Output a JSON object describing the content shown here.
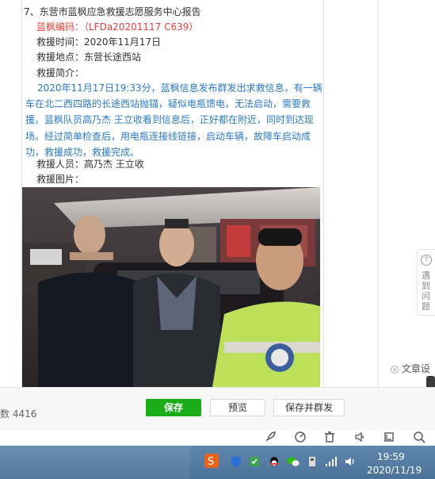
{
  "report": {
    "heading": "7、东营市蓝枫应急救援志愿服务中心报告",
    "code": "蓝枫编码：（LFDa20201117  C639）",
    "time": "救援时间：2020年11月17日",
    "place": "救援地点：东营长途西站",
    "intro_label": "救援简介：",
    "intro_lines": [
      "2020年11月17日19:33分，蓝枫信息发布群发出求救信息，有一辆",
      "车在北二西四路的长途西站抛锚，疑似电瓶馈电，无法启动，需要救",
      "援。蓝枫队员高乃杰  王立收看到信息后，正好都在附近，同时到达现",
      "场。经过简单检查后，用电瓶连接线链接，启动车辆，故障车启动成",
      "功，救援成功，救援完成。"
    ],
    "personnel": "救援人员：高乃杰 王立收",
    "image_label": "救援图片："
  },
  "side": {
    "feedback_label": "遇到问题",
    "text_settings": "文章设"
  },
  "bottom": {
    "word_count": "数 4416",
    "save": "保存",
    "preview": "预览",
    "save_group": "保存并群发"
  },
  "clock": {
    "time": "19:59",
    "date": "2020/11/19"
  },
  "colors": {
    "accent_green": "#1aad19",
    "code_red": "#e8423a",
    "body_blue": "#2b7ac7"
  }
}
